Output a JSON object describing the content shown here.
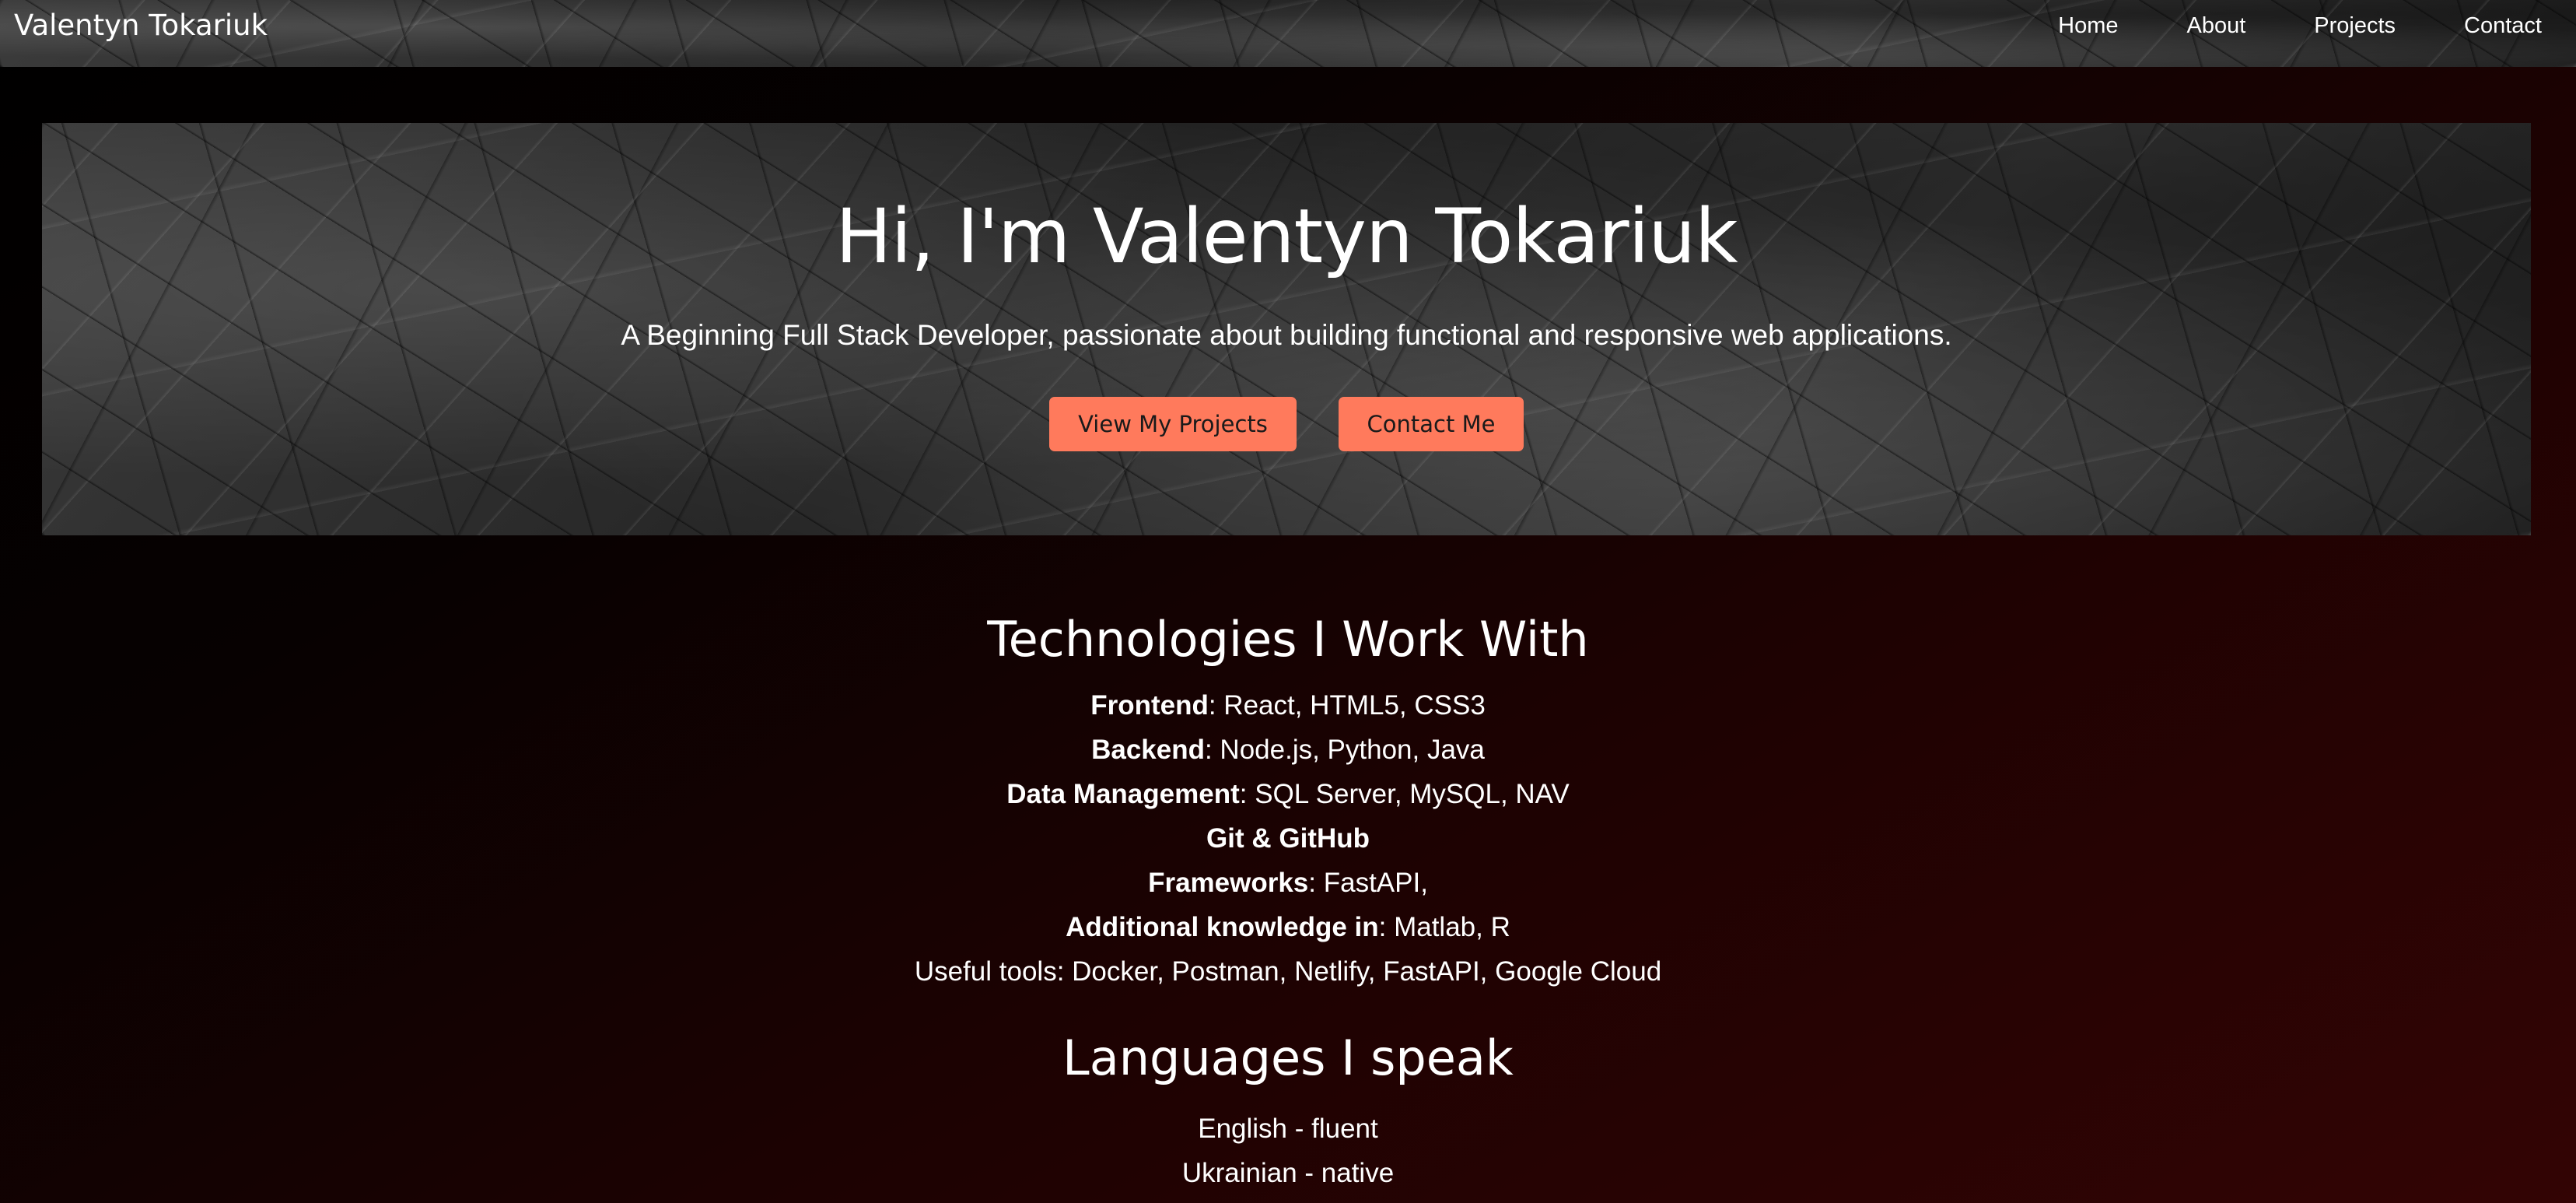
{
  "brand": "Valentyn Tokariuk",
  "nav": {
    "links": [
      "Home",
      "About",
      "Projects",
      "Contact"
    ]
  },
  "hero": {
    "title": "Hi, I'm Valentyn Tokariuk",
    "subtitle": "A Beginning Full Stack Developer, passionate about building functional and responsive web applications.",
    "buttons": {
      "projects": "View My Projects",
      "contact": "Contact Me"
    }
  },
  "technologies": {
    "title": "Technologies I Work With",
    "items": [
      {
        "label": "Frontend",
        "value": ": React, HTML5, CSS3"
      },
      {
        "label": "Backend",
        "value": ": Node.js, Python, Java"
      },
      {
        "label": "Data Management",
        "value": ": SQL Server, MySQL, NAV"
      },
      {
        "label": "Git & GitHub",
        "value": ""
      },
      {
        "label": "Frameworks",
        "value": ": FastAPI,"
      },
      {
        "label": "Additional knowledge in",
        "value": ": Matlab, R"
      },
      {
        "label": "",
        "value": "Useful tools: Docker, Postman, Netlify, FastAPI, Google Cloud"
      }
    ]
  },
  "languages": {
    "title": "Languages I speak",
    "items": [
      "English - fluent",
      "Ukrainian - native"
    ]
  },
  "colors": {
    "accent_button": "#ff7a5c",
    "background_dark": "#000000",
    "background_red": "#330404"
  }
}
